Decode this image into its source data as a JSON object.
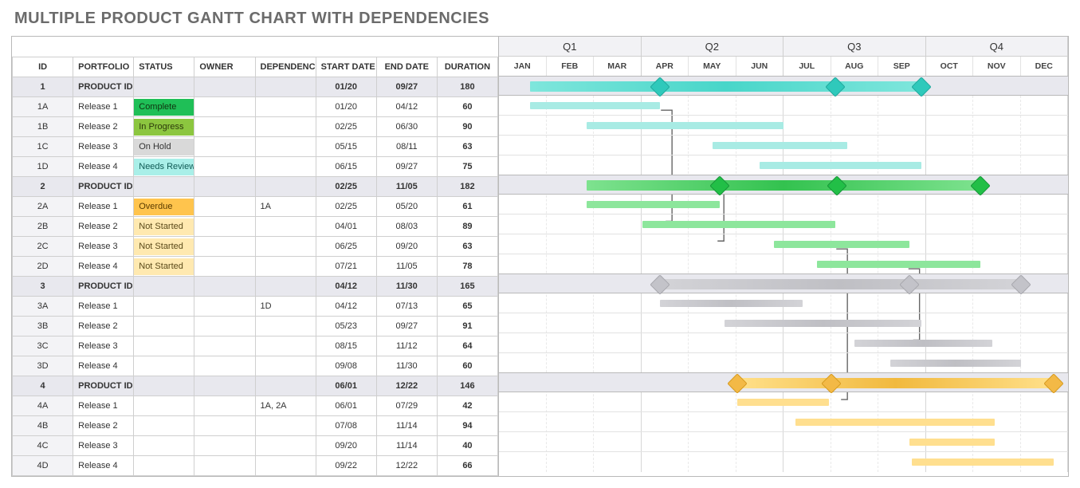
{
  "title": "MULTIPLE PRODUCT GANTT CHART WITH DEPENDENCIES",
  "columns": {
    "id": "ID",
    "portfolio": "PORTFOLIO",
    "status": "STATUS",
    "owner": "OWNER",
    "dependencies": "DEPENDENCIES",
    "start": "START DATE",
    "end": "END DATE",
    "duration": "DURATION"
  },
  "quarters": [
    "Q1",
    "Q2",
    "Q3",
    "Q4"
  ],
  "months": [
    "JAN",
    "FEB",
    "MAR",
    "APR",
    "MAY",
    "JUN",
    "JUL",
    "AUG",
    "SEP",
    "OCT",
    "NOV",
    "DEC"
  ],
  "status_colors": {
    "Complete": {
      "bg": "#1fbf57",
      "fg": "#10330f"
    },
    "In Progress": {
      "bg": "#8cc63f",
      "fg": "#2c3a0b"
    },
    "On Hold": {
      "bg": "#d9d9d9",
      "fg": "#333"
    },
    "Needs Review": {
      "bg": "#a9efe8",
      "fg": "#0f5a54"
    },
    "Overdue": {
      "bg": "#ffc44d",
      "fg": "#5a3b00"
    },
    "Not Started": {
      "bg": "#ffe9b0",
      "fg": "#5a4a1a"
    }
  },
  "chart_data": {
    "type": "gantt",
    "x_unit": "month",
    "x_range": [
      1,
      12
    ],
    "dependencies": [
      {
        "from_row": 1,
        "to_row": 7,
        "at_month": 4.4
      },
      {
        "from_row": 5,
        "to_row": 8,
        "at_month": 5.5
      },
      {
        "from_row": 9,
        "to_row": 13,
        "at_month": 9.65
      },
      {
        "from_row": 8,
        "to_row": 16,
        "at_month": 8.12
      }
    ],
    "rows": [
      {
        "id": "1",
        "portfolio": "PRODUCT ID",
        "section": true,
        "status": "",
        "owner": "",
        "deps": "",
        "start": "01/20",
        "end": "09/27",
        "duration": "180",
        "bar": {
          "from": 1.65,
          "to": 9.9,
          "style": "g-teal",
          "thick": true
        },
        "milestones": [
          4.4,
          8.1,
          9.9
        ],
        "diamond": "d-teal"
      },
      {
        "id": "1A",
        "portfolio": "Release 1",
        "section": false,
        "status": "Complete",
        "owner": "",
        "deps": "",
        "start": "01/20",
        "end": "04/12",
        "duration": "60",
        "bar": {
          "from": 1.65,
          "to": 4.4,
          "style": "g-teal-flat"
        }
      },
      {
        "id": "1B",
        "portfolio": "Release 2",
        "section": false,
        "status": "In Progress",
        "owner": "",
        "deps": "",
        "start": "02/25",
        "end": "06/30",
        "duration": "90",
        "bar": {
          "from": 2.85,
          "to": 7.0,
          "style": "g-teal-flat"
        }
      },
      {
        "id": "1C",
        "portfolio": "Release 3",
        "section": false,
        "status": "On Hold",
        "owner": "",
        "deps": "",
        "start": "05/15",
        "end": "08/11",
        "duration": "63",
        "bar": {
          "from": 5.5,
          "to": 8.35,
          "style": "g-teal-flat"
        }
      },
      {
        "id": "1D",
        "portfolio": "Release 4",
        "section": false,
        "status": "Needs Review",
        "owner": "",
        "deps": "",
        "start": "06/15",
        "end": "09/27",
        "duration": "75",
        "bar": {
          "from": 6.5,
          "to": 9.9,
          "style": "g-teal-flat"
        }
      },
      {
        "id": "2",
        "portfolio": "PRODUCT ID",
        "section": true,
        "status": "",
        "owner": "",
        "deps": "",
        "start": "02/25",
        "end": "11/05",
        "duration": "182",
        "bar": {
          "from": 2.85,
          "to": 11.15,
          "style": "g-green",
          "thick": true
        },
        "milestones": [
          5.65,
          8.12,
          11.15
        ],
        "diamond": "d-green"
      },
      {
        "id": "2A",
        "portfolio": "Release 1",
        "section": false,
        "status": "Overdue",
        "owner": "",
        "deps": "1A",
        "start": "02/25",
        "end": "05/20",
        "duration": "61",
        "bar": {
          "from": 2.85,
          "to": 5.65,
          "style": "g-green-flat"
        }
      },
      {
        "id": "2B",
        "portfolio": "Release 2",
        "section": false,
        "status": "Not Started",
        "owner": "",
        "deps": "",
        "start": "04/01",
        "end": "08/03",
        "duration": "89",
        "bar": {
          "from": 4.03,
          "to": 8.1,
          "style": "g-green-flat"
        }
      },
      {
        "id": "2C",
        "portfolio": "Release 3",
        "section": false,
        "status": "Not Started",
        "owner": "",
        "deps": "",
        "start": "06/25",
        "end": "09/20",
        "duration": "63",
        "bar": {
          "from": 6.8,
          "to": 9.65,
          "style": "g-green-flat"
        }
      },
      {
        "id": "2D",
        "portfolio": "Release 4",
        "section": false,
        "status": "Not Started",
        "owner": "",
        "deps": "",
        "start": "07/21",
        "end": "11/05",
        "duration": "78",
        "bar": {
          "from": 7.7,
          "to": 11.15,
          "style": "g-green-flat"
        }
      },
      {
        "id": "3",
        "portfolio": "PRODUCT ID",
        "section": true,
        "status": "",
        "owner": "",
        "deps": "",
        "start": "04/12",
        "end": "11/30",
        "duration": "165",
        "bar": {
          "from": 4.4,
          "to": 12.0,
          "style": "g-grey",
          "thick": true
        },
        "milestones": [
          4.4,
          9.65,
          12.0
        ],
        "diamond": "d-grey"
      },
      {
        "id": "3A",
        "portfolio": "Release 1",
        "section": false,
        "status": "",
        "owner": "",
        "deps": "1D",
        "start": "04/12",
        "end": "07/13",
        "duration": "65",
        "bar": {
          "from": 4.4,
          "to": 7.4,
          "style": "g-grey"
        }
      },
      {
        "id": "3B",
        "portfolio": "Release 2",
        "section": false,
        "status": "",
        "owner": "",
        "deps": "",
        "start": "05/23",
        "end": "09/27",
        "duration": "91",
        "bar": {
          "from": 5.75,
          "to": 9.9,
          "style": "g-grey"
        }
      },
      {
        "id": "3C",
        "portfolio": "Release 3",
        "section": false,
        "status": "",
        "owner": "",
        "deps": "",
        "start": "08/15",
        "end": "11/12",
        "duration": "64",
        "bar": {
          "from": 8.5,
          "to": 11.4,
          "style": "g-grey"
        }
      },
      {
        "id": "3D",
        "portfolio": "Release 4",
        "section": false,
        "status": "",
        "owner": "",
        "deps": "",
        "start": "09/08",
        "end": "11/30",
        "duration": "60",
        "bar": {
          "from": 9.25,
          "to": 12.0,
          "style": "g-grey"
        }
      },
      {
        "id": "4",
        "portfolio": "PRODUCT ID",
        "section": true,
        "status": "",
        "owner": "",
        "deps": "",
        "start": "06/01",
        "end": "12/22",
        "duration": "146",
        "bar": {
          "from": 6.03,
          "to": 12.7,
          "style": "g-gold",
          "thick": true
        },
        "milestones": [
          6.03,
          8.0,
          12.7
        ],
        "diamond": "d-gold"
      },
      {
        "id": "4A",
        "portfolio": "Release 1",
        "section": false,
        "status": "",
        "owner": "",
        "deps": "1A, 2A",
        "start": "06/01",
        "end": "07/29",
        "duration": "42",
        "bar": {
          "from": 6.03,
          "to": 7.95,
          "style": "g-gold-flat"
        }
      },
      {
        "id": "4B",
        "portfolio": "Release 2",
        "section": false,
        "status": "",
        "owner": "",
        "deps": "",
        "start": "07/08",
        "end": "11/14",
        "duration": "94",
        "bar": {
          "from": 7.25,
          "to": 11.45,
          "style": "g-gold-flat"
        }
      },
      {
        "id": "4C",
        "portfolio": "Release 3",
        "section": false,
        "status": "",
        "owner": "",
        "deps": "",
        "start": "09/20",
        "end": "11/14",
        "duration": "40",
        "bar": {
          "from": 9.65,
          "to": 11.45,
          "style": "g-gold-flat"
        }
      },
      {
        "id": "4D",
        "portfolio": "Release 4",
        "section": false,
        "status": "",
        "owner": "",
        "deps": "",
        "start": "09/22",
        "end": "12/22",
        "duration": "66",
        "bar": {
          "from": 9.7,
          "to": 12.7,
          "style": "g-gold-flat"
        }
      }
    ]
  }
}
